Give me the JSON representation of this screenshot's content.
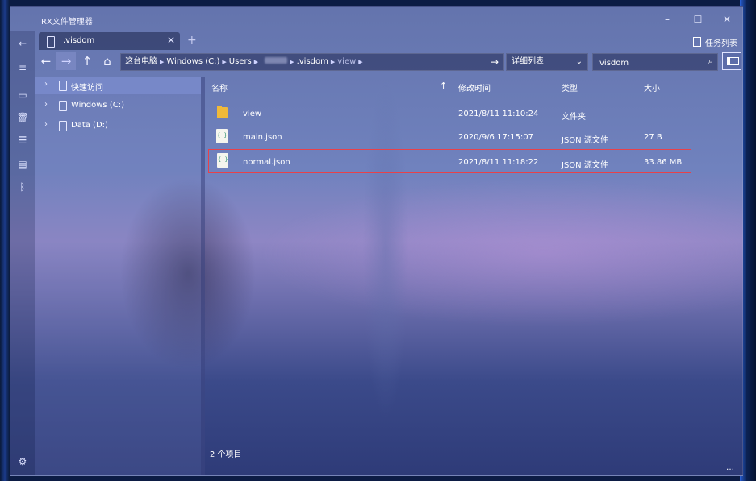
{
  "window": {
    "title": "RX文件管理器",
    "minimize_icon": "minimize-icon",
    "maximize_icon": "maximize-icon",
    "close_icon": "close-icon"
  },
  "tabs": [
    {
      "label": ".visdom",
      "icon": "device-icon",
      "active": true
    }
  ],
  "new_tab_symbol": "+",
  "task_list_label": "任务列表",
  "address": {
    "crumbs": [
      "这台电脑",
      "Windows (C:)",
      "Users",
      ".visdom",
      "view"
    ],
    "go_icon": "arrow-right-icon"
  },
  "view_mode": {
    "selected": "详细列表"
  },
  "search": {
    "value": "visdom"
  },
  "sidebar": {
    "items": [
      {
        "label": "快速访问",
        "selected": true
      },
      {
        "label": "Windows (C:)",
        "selected": false
      },
      {
        "label": "Data (D:)",
        "selected": false
      }
    ]
  },
  "columns": {
    "name": "名称",
    "modified": "修改时间",
    "type": "类型",
    "size": "大小"
  },
  "files": [
    {
      "name": "view",
      "modified": "2021/8/11 11:10:24",
      "type": "文件夹",
      "size": "",
      "icon": "folder-icon"
    },
    {
      "name": "main.json",
      "modified": "2020/9/6 17:15:07",
      "type": "JSON 源文件",
      "size": "27 B",
      "icon": "json-file-icon"
    },
    {
      "name": "normal.json",
      "modified": "2021/8/11 11:18:22",
      "type": "JSON 源文件",
      "size": "33.86 MB",
      "icon": "json-file-icon",
      "highlighted": true
    }
  ],
  "status": {
    "count": "2 个项目"
  },
  "colors": {
    "highlight_border": "#e8414a",
    "folder": "#f0b93a"
  }
}
